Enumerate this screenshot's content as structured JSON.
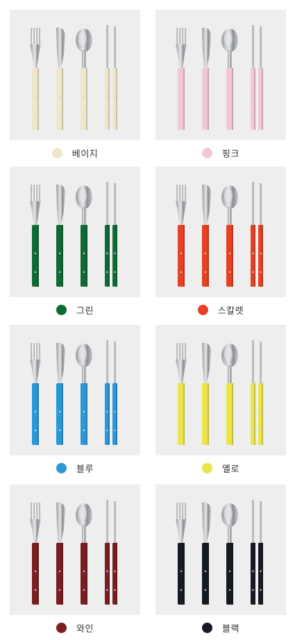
{
  "options": [
    {
      "label": "베이지",
      "color": "#efe6cc"
    },
    {
      "label": "핑크",
      "color": "#f2c8d3"
    },
    {
      "label": "그린",
      "color": "#0f6b35"
    },
    {
      "label": "스칼렛",
      "color": "#e54122"
    },
    {
      "label": "블루",
      "color": "#2a98d8"
    },
    {
      "label": "옐로",
      "color": "#ece54a"
    },
    {
      "label": "와인",
      "color": "#7a1e22"
    },
    {
      "label": "블랙",
      "color": "#161a22"
    }
  ]
}
